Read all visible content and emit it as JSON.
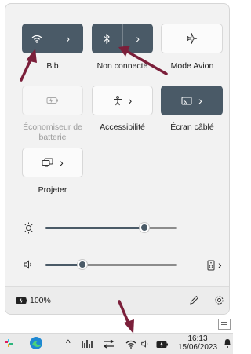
{
  "quick_settings": {
    "wifi_label": "Bib",
    "bluetooth_label": "Non connecté",
    "airplane_label": "Mode Avion",
    "battery_saver_label": "Économiseur de batterie",
    "accessibility_label": "Accessibilité",
    "cast_label": "Écran câblé",
    "project_label": "Projeter",
    "brightness_percent": 75,
    "volume_percent": 28
  },
  "footer": {
    "battery_text": "100%"
  },
  "taskbar": {
    "time": "16:13",
    "date": "15/06/2023"
  },
  "colors": {
    "accent": "#4a5a67",
    "annotation_arrow": "#7b1f3a"
  }
}
